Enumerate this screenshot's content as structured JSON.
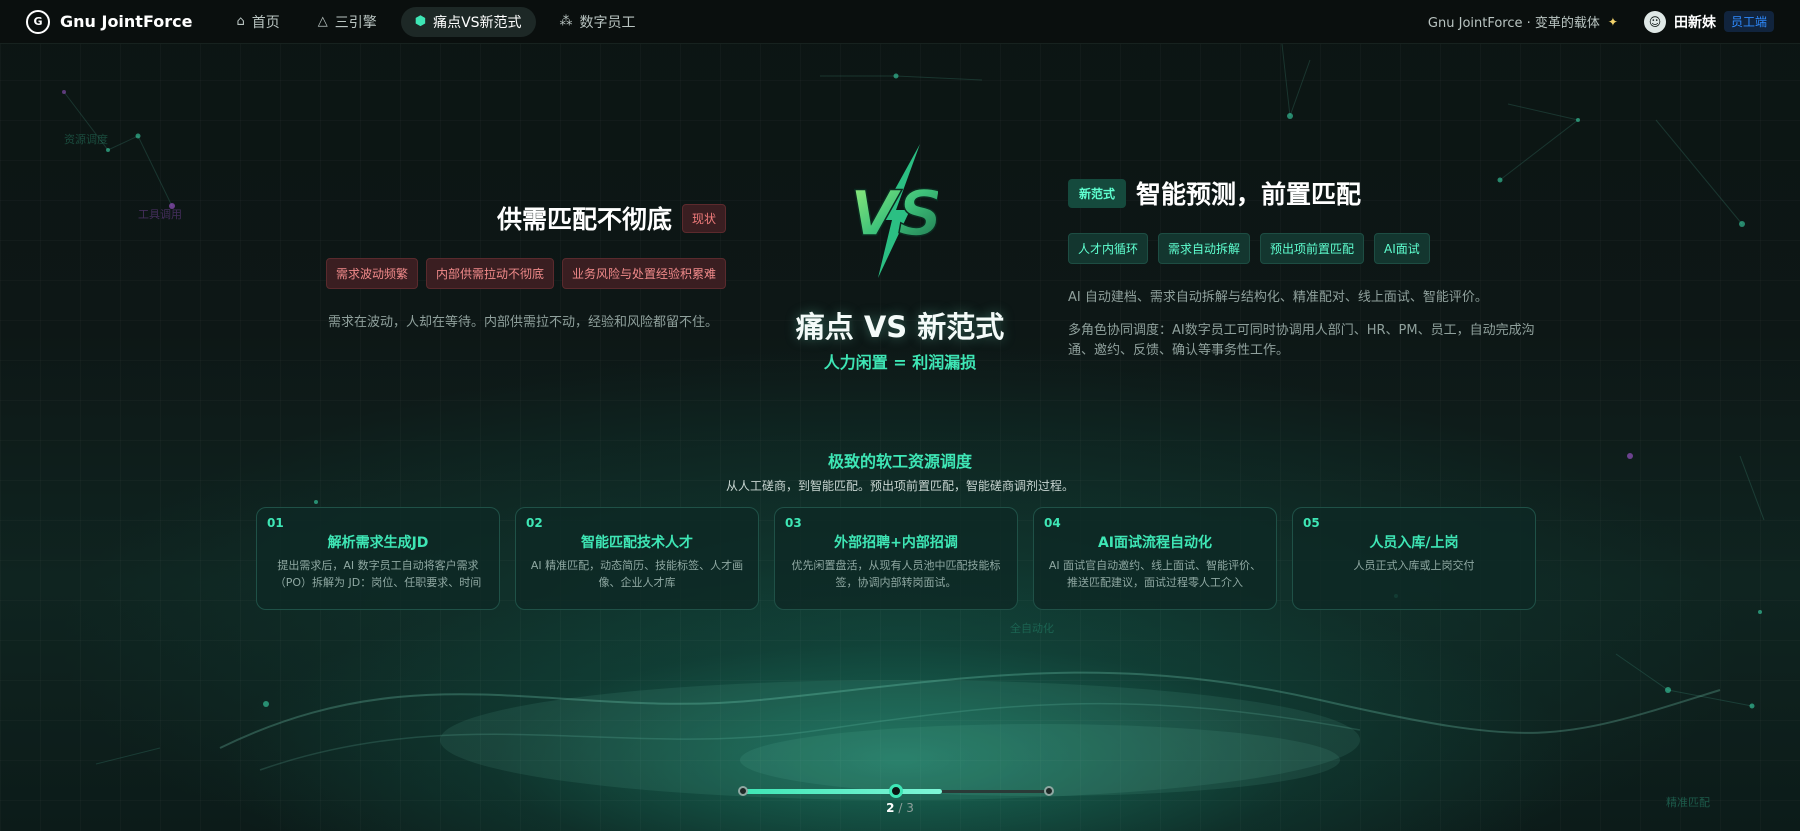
{
  "nav": {
    "brand": "Gnu JointForce",
    "items": [
      {
        "label": "首页",
        "icon": "home-icon",
        "active": false
      },
      {
        "label": "三引擎",
        "icon": "triangle-icon",
        "active": false
      },
      {
        "label": "痛点VS新范式",
        "icon": "cube-icon",
        "active": true
      },
      {
        "label": "数字员工",
        "icon": "nodes-icon",
        "active": false
      }
    ],
    "tagline": "Gnu JointForce · 变革的载体",
    "user_name": "田新妹",
    "role": "员工端"
  },
  "left": {
    "title": "供需匹配不彻底",
    "tag": "现状",
    "pills": [
      "需求波动频繁",
      "内部供需拉动不彻底",
      "业务风险与处置经验积累难"
    ],
    "description": "需求在波动，人却在等待。内部供需拉不动，经验和风险都留不住。"
  },
  "center": {
    "title": "痛点 VS 新范式",
    "subtitle": "人力闲置 = 利润漏损"
  },
  "right": {
    "tag": "新范式",
    "title": "智能预测，前置匹配",
    "pills": [
      "人才内循环",
      "需求自动拆解",
      "预出项前置匹配",
      "AI面试"
    ],
    "description_1": "AI 自动建档、需求自动拆解与结构化、精准配对、线上面试、智能评价。",
    "description_2": "多角色协同调度：AI数字员工可同时协调用人部门、HR、PM、员工，自动完成沟通、邀约、反馈、确认等事务性工作。"
  },
  "process": {
    "title": "极致的软工资源调度",
    "subtitle": "从人工磋商，到智能匹配。预出项前置匹配，智能磋商调剂过程。",
    "steps": [
      {
        "num": "01",
        "title": "解析需求生成JD",
        "desc": "提出需求后，AI 数字员工自动将客户需求（PO）拆解为 JD：岗位、任职要求、时间"
      },
      {
        "num": "02",
        "title": "智能匹配技术人才",
        "desc": "AI 精准匹配，动态简历、技能标签、人才画像、企业人才库"
      },
      {
        "num": "03",
        "title": "外部招聘+内部招调",
        "desc": "优先闲置盘活，从现有人员池中匹配技能标签，协调内部转岗面试。"
      },
      {
        "num": "04",
        "title": "AI面试流程自动化",
        "desc": "AI 面试官自动邀约、线上面试、智能评价、推送匹配建议，面试过程零人工介入"
      },
      {
        "num": "05",
        "title": "人员入库/上岗",
        "desc": "人员正式入库或上岗交付"
      }
    ]
  },
  "background_labels": [
    "资源调度",
    "工具调用",
    "全自动化",
    "精准匹配"
  ],
  "pager": {
    "current": "2",
    "separator": "/",
    "total": "3",
    "progress": 0.667
  },
  "colors": {
    "accent": "#3ee6b5",
    "danger": "#f07b7b",
    "background": "#0b1412"
  }
}
